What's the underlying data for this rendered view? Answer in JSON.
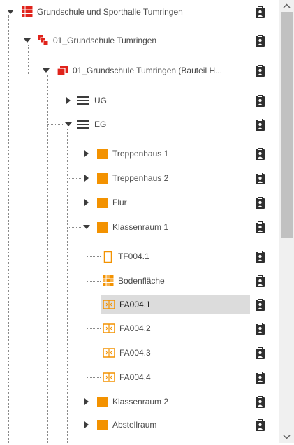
{
  "tree": {
    "nodes": [
      {
        "label": "Grundschule und Sporthalle Tumringen",
        "icon": "red-grid-icon",
        "toggle": "expanded"
      },
      {
        "label": "01_Grundschule Tumringen",
        "icon": "red-stack-icon",
        "toggle": "expanded"
      },
      {
        "label": "01_Grundschule Tumringen (Bauteil H...",
        "icon": "red-layers-icon",
        "toggle": "expanded"
      },
      {
        "label": "UG",
        "icon": "floor-lines-icon",
        "toggle": "collapsed"
      },
      {
        "label": "EG",
        "icon": "floor-lines-icon",
        "toggle": "expanded"
      },
      {
        "label": "Treppenhaus 1",
        "icon": "orange-room-icon",
        "toggle": "collapsed"
      },
      {
        "label": "Treppenhaus 2",
        "icon": "orange-room-icon",
        "toggle": "collapsed"
      },
      {
        "label": "Flur",
        "icon": "orange-room-icon",
        "toggle": "collapsed"
      },
      {
        "label": "Klassenraum 1",
        "icon": "orange-room-icon",
        "toggle": "expanded"
      },
      {
        "label": "TF004.1",
        "icon": "outline-rect-icon",
        "toggle": "none"
      },
      {
        "label": "Bodenfläche",
        "icon": "dotted-grid-icon",
        "toggle": "none"
      },
      {
        "label": "FA004.1",
        "icon": "window-icon",
        "toggle": "none",
        "selected": true
      },
      {
        "label": "FA004.2",
        "icon": "window-icon",
        "toggle": "none"
      },
      {
        "label": "FA004.3",
        "icon": "window-icon",
        "toggle": "none"
      },
      {
        "label": "FA004.4",
        "icon": "window-icon",
        "toggle": "none"
      },
      {
        "label": "Klassenraum 2",
        "icon": "orange-room-icon",
        "toggle": "collapsed"
      },
      {
        "label": "Abstellraum",
        "icon": "orange-room-icon",
        "toggle": "collapsed"
      }
    ],
    "action_icon": "clipboard-person-icon"
  },
  "scrollbar": {
    "scroll_fraction": 0.0,
    "visible_fraction": 0.54
  },
  "colors": {
    "red": "#e0231b",
    "orange": "#f39200",
    "selection": "#dcdcdc",
    "text": "#4a4a4a"
  }
}
